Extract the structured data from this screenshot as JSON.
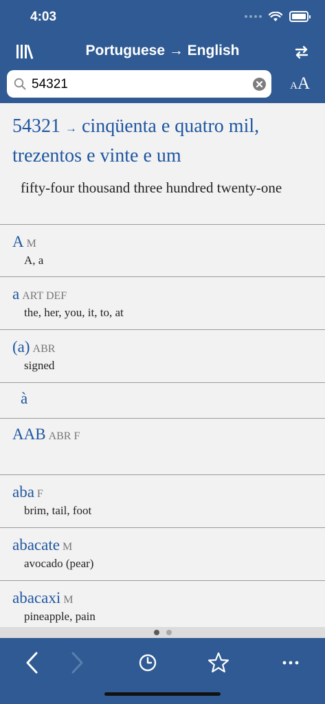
{
  "status": {
    "time": "4:03"
  },
  "header": {
    "title": "Portuguese → English",
    "library_icon": "library-icon",
    "swap_icon": "swap-languages-icon"
  },
  "search": {
    "value": "54321",
    "placeholder": ""
  },
  "font_size": {
    "small": "A",
    "large": "A"
  },
  "top_result": {
    "term": "54321",
    "arrow": "→",
    "portuguese": "cinqüenta e quatro mil, trezentos e vinte e um",
    "english": "fifty-four thousand three hundred twenty-one"
  },
  "entries": [
    {
      "headword": "A",
      "pos": "M",
      "translation": "A, a"
    },
    {
      "headword": "a",
      "pos": "ART DEF",
      "translation": "the, her, you, it, to, at"
    },
    {
      "headword": "(a)",
      "pos": "ABR",
      "translation": "signed"
    },
    {
      "headword": "à",
      "pos": "",
      "translation": ""
    },
    {
      "headword": "AAB",
      "pos": "ABR F",
      "translation": ""
    },
    {
      "headword": "aba",
      "pos": "F",
      "translation": "brim, tail, foot"
    },
    {
      "headword": "abacate",
      "pos": "M",
      "translation": "avocado (pear)"
    },
    {
      "headword": "abacaxi",
      "pos": "M",
      "translation": "pineapple, pain"
    }
  ],
  "pager": {
    "pages": 2,
    "active": 1
  },
  "toolbar": {
    "back_icon": "chevron-left-icon",
    "forward_icon": "chevron-right-icon",
    "history_icon": "clock-icon",
    "favorites_icon": "star-icon",
    "more_icon": "more-icon"
  },
  "colors": {
    "bar": "#2f5a93",
    "headword": "#1e56a0"
  }
}
